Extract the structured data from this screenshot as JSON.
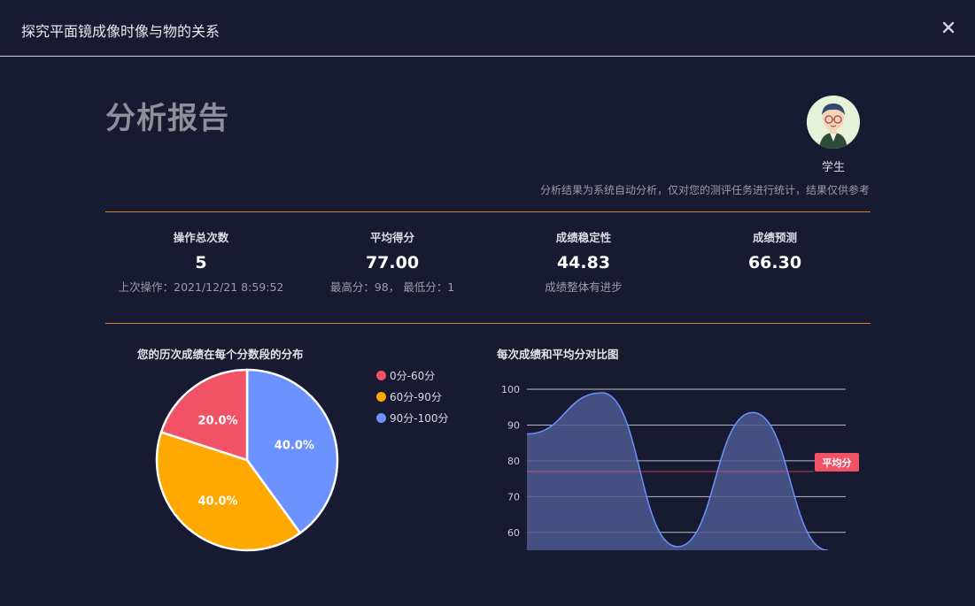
{
  "window": {
    "title": "探究平面镜成像时像与物的关系"
  },
  "report": {
    "title": "分析报告",
    "user_label": "学生",
    "disclaimer": "分析结果为系统自动分析，仅对您的测评任务进行统计，结果仅供参考"
  },
  "stats": [
    {
      "label": "操作总次数",
      "value": "5",
      "sub": "上次操作：2021/12/21 8:59:52"
    },
    {
      "label": "平均得分",
      "value": "77.00",
      "sub": "最高分：98， 最低分：1"
    },
    {
      "label": "成绩稳定性",
      "value": "44.83",
      "sub": "成绩整体有进步"
    },
    {
      "label": "成绩预测",
      "value": "66.30",
      "sub": ""
    }
  ],
  "colors": {
    "accent_line": "#c8882a",
    "red": "#f25266",
    "orange": "#ffa800",
    "blue": "#6b92ff",
    "area_fill": "#4b5a8f",
    "area_stroke": "#6b92ff",
    "avg_line": "#f25266"
  },
  "chart_data": [
    {
      "type": "pie",
      "title": "您的历次成绩在每个分数段的分布",
      "legend_position": "right",
      "categories": [
        "0分-60分",
        "60分-90分",
        "90分-100分"
      ],
      "values": [
        20.0,
        40.0,
        40.0
      ],
      "labels": [
        "20.0%",
        "40.0%",
        "40.0%"
      ],
      "colors": [
        "#f25266",
        "#ffa800",
        "#6b92ff"
      ]
    },
    {
      "type": "area",
      "title": "每次成绩和平均分对比图",
      "yticks": [
        "100",
        "90",
        "80",
        "70",
        "60"
      ],
      "ylim": [
        55,
        100
      ],
      "series": [
        {
          "values": [
            87.5,
            99,
            56,
            93.5,
            55
          ]
        }
      ],
      "reference_line": {
        "label": "平均分",
        "value": 77
      }
    }
  ]
}
